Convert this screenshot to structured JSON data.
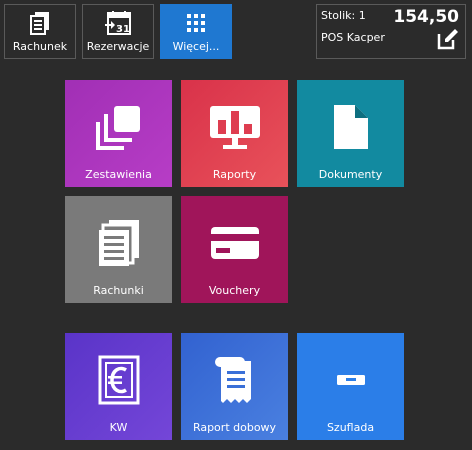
{
  "toolbar": {
    "rachunek": "Rachunek",
    "rezerwacje": "Rezerwacje",
    "rezerwacje_day": "31",
    "wiecej": "Więcej..."
  },
  "info": {
    "table": "Stolik: 1",
    "pos": "POS Kacper",
    "amount": "154,50"
  },
  "tiles": {
    "zestawienia": "Zestawienia",
    "raporty": "Raporty",
    "dokumenty": "Dokumenty",
    "rachunki": "Rachunki",
    "vouchery": "Vouchery",
    "kw": "KW",
    "raport_dobowy": "Raport dobowy",
    "szuflada": "Szuflada"
  },
  "colors": {
    "background": "#2b2b2b",
    "active": "#1f78d1",
    "zestawienia": "#a52fb8",
    "raporty": "#e0404f",
    "dokumenty": "#128aa0",
    "rachunki": "#7a7a7a",
    "vouchery": "#a0155a",
    "kw": "#6b3fd0",
    "raport_dobowy": "#3b6ed8",
    "szuflada": "#2b7ee8"
  }
}
